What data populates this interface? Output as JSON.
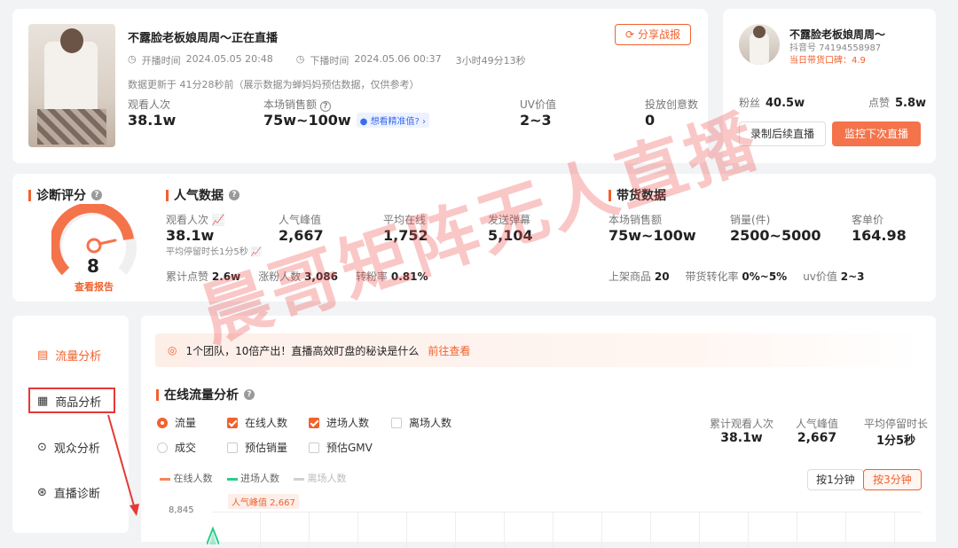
{
  "live": {
    "title": "不露脸老板娘周周～正在直播",
    "start_label": "开播时间",
    "start_time": "2024.05.05 20:48",
    "end_label": "下播时间",
    "end_time": "2024.05.06 00:37",
    "duration": "3小时49分13秒",
    "update_note": "数据更新于 41分28秒前（展示数据为蝉妈妈预估数据，仅供参考）",
    "share_label": "分享战报",
    "stats": [
      {
        "label": "观看人次",
        "value": "38.1w"
      },
      {
        "label": "本场销售额",
        "value": "75w~100w"
      },
      {
        "label": "UV价值",
        "value": "2~3"
      },
      {
        "label": "投放创意数",
        "value": "0"
      }
    ],
    "precise_link": "想看精准值?"
  },
  "anchor": {
    "name": "不露脸老板娘周周～",
    "douyin_id": "抖音号 74194558987",
    "reputation": "当日带货口碑：4.9",
    "fans_label": "粉丝",
    "fans_value": "40.5w",
    "likes_label": "点赞",
    "likes_value": "5.8w",
    "record_btn": "录制后续直播",
    "monitor_btn": "监控下次直播"
  },
  "diagnosis": {
    "title": "诊断评分",
    "score": "8",
    "report_link": "查看报告",
    "score_fraction": 0.8
  },
  "popularity": {
    "title": "人气数据",
    "stats": [
      {
        "label": "观看人次",
        "value": "38.1w"
      },
      {
        "label": "人气峰值",
        "value": "2,667"
      },
      {
        "label": "平均在线",
        "value": "1,752"
      },
      {
        "label": "发送弹幕",
        "value": "5,104"
      }
    ],
    "avg_stay": "平均停留时长1分5秒",
    "row2": [
      {
        "label": "累计点赞",
        "value": "2.6w"
      },
      {
        "label": "涨粉人数",
        "value": "3,086"
      },
      {
        "label": "转粉率",
        "value": "0.81%"
      }
    ]
  },
  "sales": {
    "title": "带货数据",
    "stats": [
      {
        "label": "本场销售额",
        "value": "75w~100w"
      },
      {
        "label": "销量(件)",
        "value": "2500~5000"
      },
      {
        "label": "客单价",
        "value": "164.98"
      }
    ],
    "row2": [
      {
        "label": "上架商品",
        "value": "20"
      },
      {
        "label": "带货转化率",
        "value": "0%~5%"
      },
      {
        "label": "uv价值",
        "value": "2~3"
      }
    ]
  },
  "sidenav": {
    "items": [
      {
        "label": "流量分析"
      },
      {
        "label": "商品分析"
      },
      {
        "label": "观众分析"
      },
      {
        "label": "直播诊断"
      }
    ]
  },
  "banner": {
    "text": "1个团队，10倍产出！直播高效盯盘的秘诀是什么",
    "link": "前往查看"
  },
  "traffic": {
    "title": "在线流量分析",
    "options_row1": [
      {
        "label": "流量",
        "type": "radio",
        "checked": true
      },
      {
        "label": "在线人数",
        "type": "check",
        "checked": true
      },
      {
        "label": "进场人数",
        "type": "check",
        "checked": true
      },
      {
        "label": "离场人数",
        "type": "check",
        "checked": false
      }
    ],
    "options_row2": [
      {
        "label": "成交",
        "type": "radio",
        "checked": false
      },
      {
        "label": "预估销量",
        "type": "check",
        "checked": false
      },
      {
        "label": "预估GMV",
        "type": "check",
        "checked": false
      }
    ],
    "summary": [
      {
        "label": "累计观看人次",
        "value": "38.1w"
      },
      {
        "label": "人气峰值",
        "value": "2,667"
      },
      {
        "label": "平均停留时长",
        "value": "1分5秒"
      }
    ],
    "legend": [
      {
        "label": "在线人数",
        "color": "#f5845c"
      },
      {
        "label": "进场人数",
        "color": "#2ecb8b"
      },
      {
        "label": "离场人数",
        "color": "#d0d0d0"
      }
    ],
    "interval_1": "按1分钟",
    "interval_3": "按3分钟",
    "y_top": "8,845",
    "peak_label": "人气峰值 2,667"
  },
  "watermark": "晨哥矩阵无人直播",
  "colors": {
    "accent": "#f0622f",
    "highlight_box": "#e53935"
  }
}
